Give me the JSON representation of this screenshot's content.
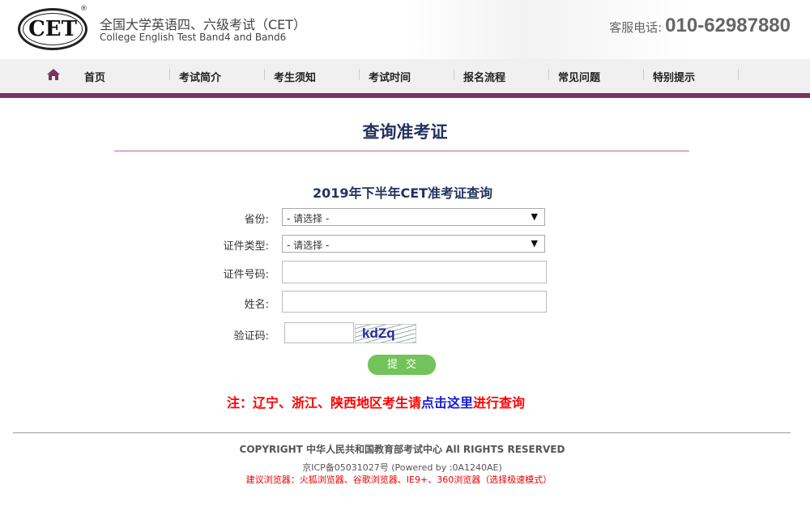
{
  "header": {
    "logo_text": "CET",
    "registered": "®",
    "title_cn": "全国大学英语四、六级考试（CET）",
    "title_en": "College English Test Band4 and Band6",
    "hotline_label": "客服电话:",
    "hotline_number": "010-62987880"
  },
  "nav": {
    "home_icon": "home-icon",
    "items": [
      "首页",
      "考试简介",
      "考生须知",
      "考试时间",
      "报名流程",
      "常见问题",
      "特别提示"
    ]
  },
  "page_title": "查询准考证",
  "form": {
    "title": "2019年下半年CET准考证查询",
    "province_label": "省份:",
    "province_value": "- 请选择 -",
    "idtype_label": "证件类型:",
    "idtype_value": "- 请选择 -",
    "idnum_label": "证件号码:",
    "idnum_value": "",
    "name_label": "姓名:",
    "name_value": "",
    "captcha_label": "验证码:",
    "captcha_value": "",
    "captcha_text": "kdZq",
    "submit_label": "提交"
  },
  "note": {
    "prefix": "注：辽宁、浙江、陕西地区考生请",
    "link": "点击这里",
    "suffix": "进行查询"
  },
  "footer": {
    "copyright": "COPYRIGHT 中华人民共和国教育部考试中心 All RIGHTS RESERVED",
    "icp": "京ICP备05031027号 (Powered by :0A1240AE)",
    "browsers": "建议浏览器：火狐浏览器、谷歌浏览器、IE9+、360浏览器（选择极速模式）"
  },
  "colors": {
    "brand": "#7a3363",
    "title": "#23325f",
    "submit": "#73c35b",
    "note": "#ff0000",
    "link": "#1a1adb"
  }
}
